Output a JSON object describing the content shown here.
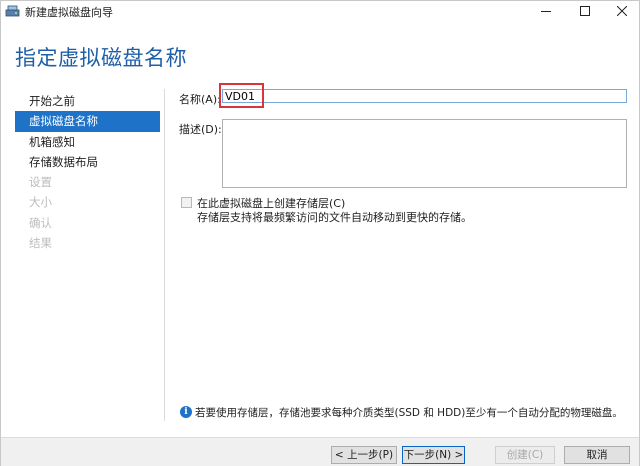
{
  "window": {
    "title": "新建虚拟磁盘向导",
    "icons": {
      "app": "disk-wizard-icon",
      "minimize": "minimize-icon",
      "maximize": "maximize-icon",
      "close": "close-icon"
    }
  },
  "page": {
    "title": "指定虚拟磁盘名称"
  },
  "nav": {
    "items": [
      {
        "label": "开始之前",
        "state": "normal"
      },
      {
        "label": "虚拟磁盘名称",
        "state": "active"
      },
      {
        "label": "机箱感知",
        "state": "normal"
      },
      {
        "label": "存储数据布局",
        "state": "normal"
      },
      {
        "label": "设置",
        "state": "disabled"
      },
      {
        "label": "大小",
        "state": "disabled"
      },
      {
        "label": "确认",
        "state": "disabled"
      },
      {
        "label": "结果",
        "state": "disabled"
      }
    ]
  },
  "form": {
    "name_label": "名称(A):",
    "name_value": "VD01",
    "description_label": "描述(D):",
    "description_value": "",
    "tier_checkbox_label": "在此虚拟磁盘上创建存储层(C)",
    "tier_checkbox_checked": false,
    "tier_description": "存储层支持将最频繁访问的文件自动移动到更快的存储。"
  },
  "info": {
    "icon": "info-icon",
    "text": "若要使用存储层，存储池要求每种介质类型(SSD 和 HDD)至少有一个自动分配的物理磁盘。"
  },
  "footer": {
    "prev_label": "< 上一步(P)",
    "next_label": "下一步(N) >",
    "create_label": "创建(C)",
    "cancel_label": "取消"
  },
  "colors": {
    "accent": "#1e72c8",
    "title": "#1f5fa7",
    "highlight": "#d9343a",
    "disabled_text": "#bdbdbd"
  }
}
